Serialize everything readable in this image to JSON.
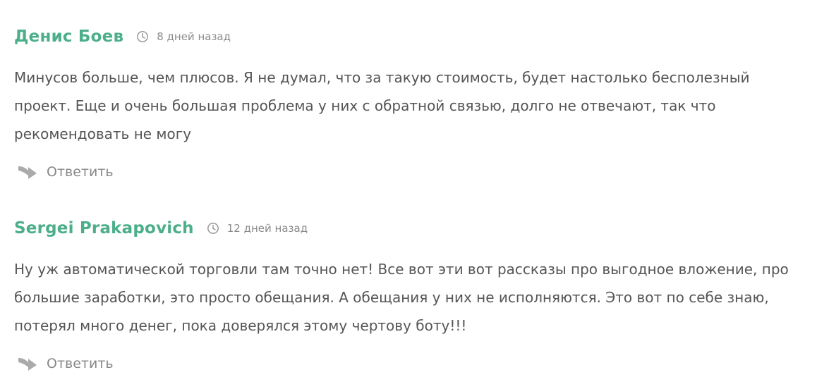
{
  "comments": [
    {
      "author": "Денис Боев",
      "time": "8 дней назад",
      "text": "Минусов больше, чем плюсов. Я не думал, что за такую стоимость, будет настолько бесполезный проект. Еще и очень большая проблема у них с обратной связью, долго не отвечают, так что рекомендовать не могу",
      "reply_label": "Ответить"
    },
    {
      "author": "Sergei Prakapovich",
      "time": "12 дней назад",
      "text": "Ну уж автоматической торговли там точно нет! Все вот эти вот рассказы про выгодное вложение, про большие заработки, это просто обещания. А обещания у них не исполняются. Это вот по себе знаю, потерял много денег, пока доверялся этому чертову боту!!!",
      "reply_label": "Ответить"
    }
  ],
  "colors": {
    "author": "#4caf8a",
    "text": "#555555",
    "meta": "#8a8a8a",
    "reply_icon": "#aaaaaa"
  },
  "icons": {
    "time": "clock-icon",
    "reply": "reply-arrow-icon"
  }
}
